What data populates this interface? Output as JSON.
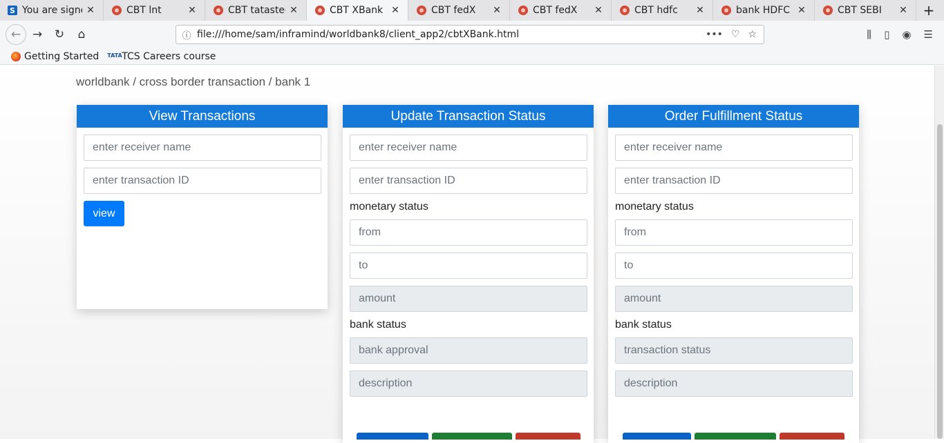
{
  "browser": {
    "tabs": [
      {
        "title": "You are signed",
        "icon": "s-icon"
      },
      {
        "title": "CBT lnt",
        "icon": "site-icon"
      },
      {
        "title": "CBT tatasteel",
        "icon": "site-icon"
      },
      {
        "title": "CBT XBank",
        "icon": "site-icon"
      },
      {
        "title": "CBT fedX",
        "icon": "site-icon"
      },
      {
        "title": "CBT fedX",
        "icon": "site-icon"
      },
      {
        "title": "CBT hdfc",
        "icon": "site-icon"
      },
      {
        "title": "bank HDFC",
        "icon": "site-icon"
      },
      {
        "title": "CBT SEBI",
        "icon": "site-icon"
      }
    ],
    "active_tab": 3,
    "url": "file:///home/sam/inframind/worldbank8/client_app2/cbtXBank.html",
    "bookmarks": [
      "Getting Started",
      "TCS Careers course"
    ],
    "tcs_logo_text": "TATA"
  },
  "page": {
    "breadcrumb": "worldbank / cross border transaction / bank 1",
    "view_card": {
      "title": "View Transactions",
      "receiver_placeholder": "enter receiver name",
      "txid_placeholder": "enter transaction ID",
      "view_label": "view"
    },
    "update_card": {
      "title": "Update Transaction Status",
      "receiver_placeholder": "enter receiver name",
      "txid_placeholder": "enter transaction ID",
      "monetary_label": "monetary status",
      "from_placeholder": "from",
      "to_placeholder": "to",
      "amount_placeholder": "amount",
      "bank_status_label": "bank status",
      "bank_approval_placeholder": "bank approval",
      "description_placeholder": "description"
    },
    "order_card": {
      "title": "Order Fulfillment Status",
      "receiver_placeholder": "enter receiver name",
      "txid_placeholder": "enter transaction ID",
      "monetary_label": "monetary status",
      "from_placeholder": "from",
      "to_placeholder": "to",
      "amount_placeholder": "amount",
      "bank_status_label": "bank status",
      "transaction_status_placeholder": "transaction status",
      "description_placeholder": "description"
    }
  },
  "colors": {
    "header_blue": "#1479d9",
    "primary_button": "#007bff",
    "success_button": "#1e7e34",
    "danger_button": "#c0392b"
  }
}
